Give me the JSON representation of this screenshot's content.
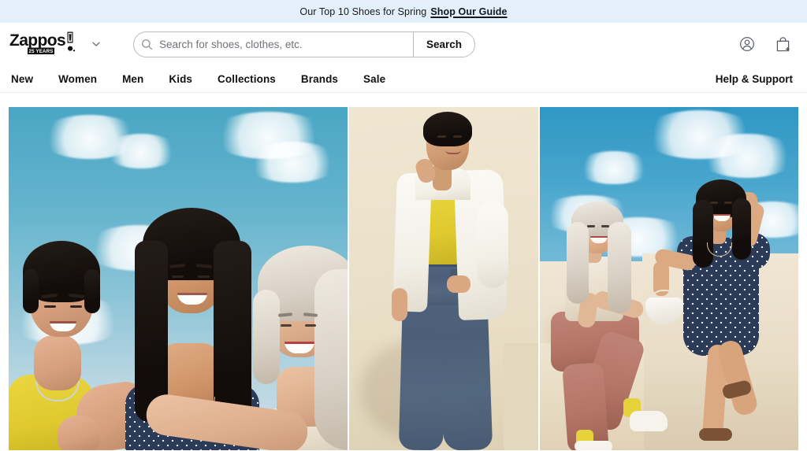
{
  "promo": {
    "text": "Our Top 10 Shoes for Spring",
    "link_label": "Shop Our Guide",
    "background_color": "#e3f0fc"
  },
  "header": {
    "logo": {
      "wordmark": "Zappos",
      "badge": "25 YEARS",
      "name": "zappos-logo"
    },
    "logo_dropdown_icon": "chevron-down-icon",
    "search": {
      "placeholder": "Search for shoes, clothes, etc.",
      "value": "",
      "icon": "search-icon",
      "button_label": "Search"
    },
    "actions": [
      {
        "name": "account-icon",
        "label": "Account"
      },
      {
        "name": "shopping-bag-icon",
        "label": "Cart"
      }
    ]
  },
  "nav": {
    "items": [
      {
        "label": "New"
      },
      {
        "label": "Women"
      },
      {
        "label": "Men"
      },
      {
        "label": "Kids"
      },
      {
        "label": "Collections"
      },
      {
        "label": "Brands"
      },
      {
        "label": "Sale"
      }
    ],
    "help_label": "Help & Support"
  },
  "hero": {
    "panels": [
      {
        "name": "hero-panel-three-women-sky",
        "description": "Three smiling women outdoors against a blue sky with clouds; yellow tank top, navy polka-dot dress, cream knit top",
        "background": "#63b3cd"
      },
      {
        "name": "hero-panel-woman-white-shirt",
        "description": "Woman in oversized white shirt, yellow crop top and wide-leg blue jeans on a cream studio backdrop",
        "background": "#ece2cc"
      },
      {
        "name": "hero-panel-two-women-wall",
        "description": "Two women on a cream wall against a blue cloudy sky; cream knit top with rust pants and yellow socks, navy polka-dot dress with white handbag",
        "background": "#49a6cd"
      }
    ]
  }
}
